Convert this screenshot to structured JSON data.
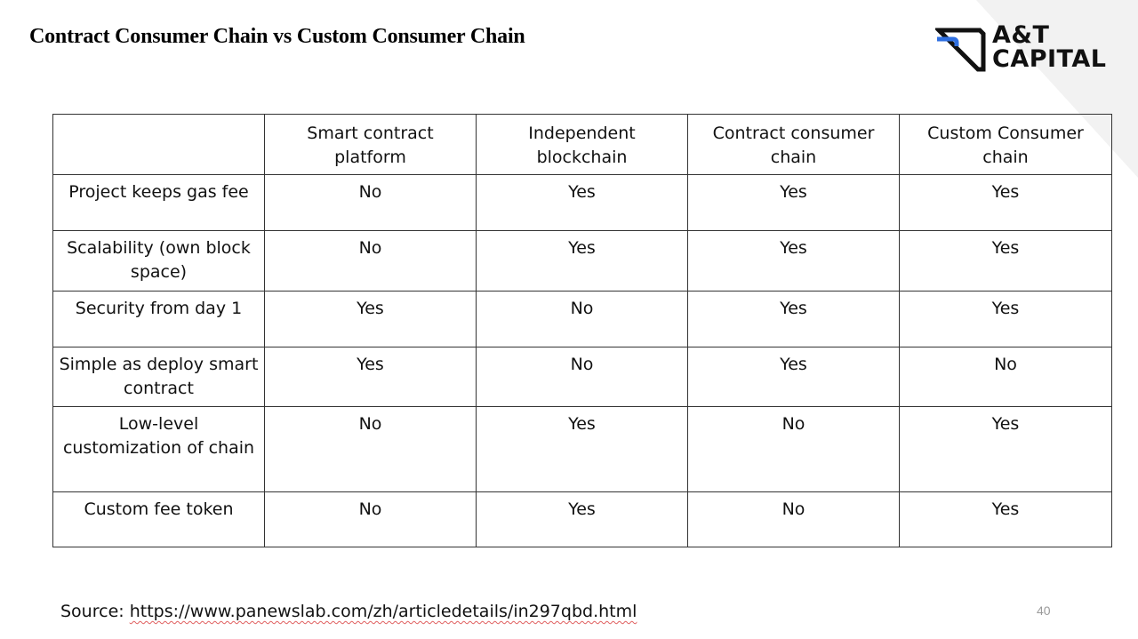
{
  "title": "Contract Consumer Chain vs Custom Consumer Chain",
  "logo": {
    "line1": "A&T",
    "line2": "CAPITAL",
    "icon": "at-capital-logo-icon"
  },
  "colors": {
    "yes": "#22a84a",
    "no": "#e00d0d",
    "border": "#333333"
  },
  "table": {
    "columns": [
      "",
      "Smart contract platform",
      "Independent blockchain",
      "Contract consumer chain",
      "Custom Consumer chain"
    ],
    "rows": [
      {
        "label": "Project keeps gas fee",
        "values": [
          "No",
          "Yes",
          "Yes",
          "Yes"
        ]
      },
      {
        "label": "Scalability (own block space)",
        "values": [
          "No",
          "Yes",
          "Yes",
          "Yes"
        ]
      },
      {
        "label": "Security from day 1",
        "values": [
          "Yes",
          "No",
          "Yes",
          "Yes"
        ]
      },
      {
        "label": "Simple as deploy smart contract",
        "values": [
          "Yes",
          "No",
          "Yes",
          "No"
        ]
      },
      {
        "label": "Low-level customization of chain",
        "values": [
          "No",
          "Yes",
          "No",
          "Yes"
        ]
      },
      {
        "label": "Custom fee token",
        "values": [
          "No",
          "Yes",
          "No",
          "Yes"
        ]
      }
    ]
  },
  "source": {
    "prefix": "Source: ",
    "url": "https://www.panewslab.com/zh/articledetails/in297qbd.html"
  },
  "page_number": "40"
}
